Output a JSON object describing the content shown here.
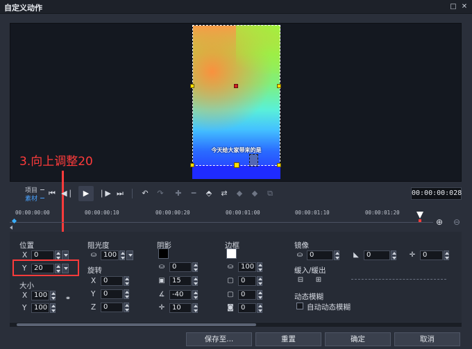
{
  "window": {
    "title": "自定义动作",
    "maximize_icon": "maximize-icon",
    "close_icon": "close-icon"
  },
  "preview": {
    "caption": "今天给大家带来的是",
    "annotation": "3.向上调整20"
  },
  "transport": {
    "project_label": "项目",
    "material_label": "素材",
    "timecode": "00:00:00:028"
  },
  "ruler": {
    "ticks": [
      "00:00:00:00",
      "00:00:00:10",
      "00:00:00:20",
      "00:00:01:00",
      "00:00:01:10",
      "00:00:01:20"
    ]
  },
  "position": {
    "title": "位置",
    "x_label": "X",
    "x_value": "0",
    "y_label": "Y",
    "y_value": "20"
  },
  "size": {
    "title": "大小",
    "x_label": "X",
    "x_value": "100",
    "y_label": "Y",
    "y_value": "100"
  },
  "opacity": {
    "title": "阻光度",
    "value": "100"
  },
  "rotation": {
    "title": "旋转",
    "x_label": "X",
    "x_value": "0",
    "y_label": "Y",
    "y_value": "0",
    "z_label": "Z",
    "z_value": "0"
  },
  "shadow": {
    "title": "阴影",
    "color": "#000000",
    "v1": "0",
    "v2": "15",
    "v3": "-40",
    "v4": "10"
  },
  "border": {
    "title": "边框",
    "color": "#ffffff",
    "v1": "100",
    "v2": "0",
    "v3": "0",
    "v4": "0"
  },
  "mirror": {
    "title": "镜像",
    "v1": "0",
    "v2": "0",
    "v3": "0"
  },
  "easing": {
    "title": "缓入/缓出"
  },
  "motion_blur": {
    "title": "动态模糊",
    "checkbox_label": "自动动态模糊"
  },
  "buttons": {
    "save_as": "保存至...",
    "reset": "重置",
    "ok": "确定",
    "cancel": "取消"
  }
}
